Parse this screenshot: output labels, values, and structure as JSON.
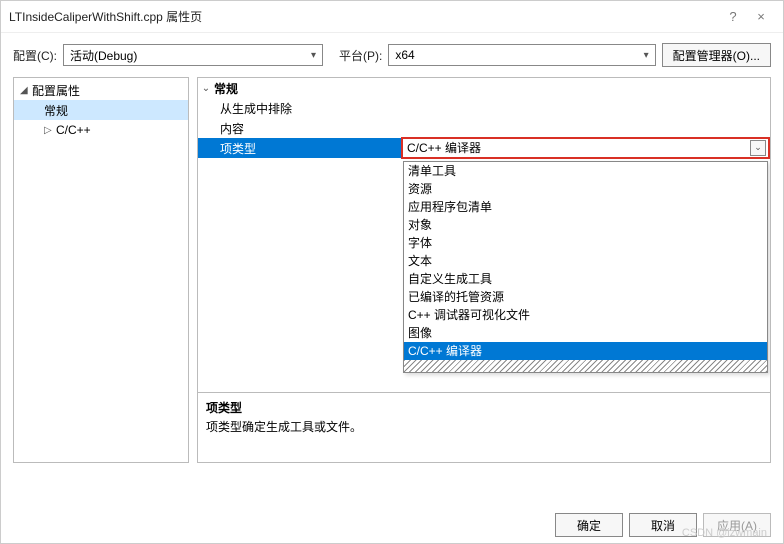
{
  "window": {
    "title": "LTInsideCaliperWithShift.cpp 属性页",
    "help": "?",
    "close": "×"
  },
  "config": {
    "label": "配置(C):",
    "value": "活动(Debug)",
    "platformLabel": "平台(P):",
    "platformValue": "x64",
    "managerBtn": "配置管理器(O)..."
  },
  "tree": {
    "root": "配置属性",
    "general": "常规",
    "cpp": "C/C++"
  },
  "grid": {
    "category": "常规",
    "rows": {
      "exclude": {
        "name": "从生成中排除",
        "value": ""
      },
      "content": {
        "name": "内容",
        "value": ""
      },
      "itemType": {
        "name": "项类型",
        "value": "C/C++ 编译器"
      }
    }
  },
  "dropdown": {
    "options": [
      "清单工具",
      "资源",
      "应用程序包清单",
      "对象",
      "字体",
      "文本",
      "自定义生成工具",
      "已编译的托管资源",
      "C++ 调试器可视化文件",
      "图像",
      "C/C++ 编译器"
    ],
    "selected": "C/C++ 编译器"
  },
  "desc": {
    "title": "项类型",
    "text": "项类型确定生成工具或文件。"
  },
  "buttons": {
    "ok": "确定",
    "cancel": "取消",
    "apply": "应用(A)"
  },
  "watermark": "CSDN @izwmain"
}
